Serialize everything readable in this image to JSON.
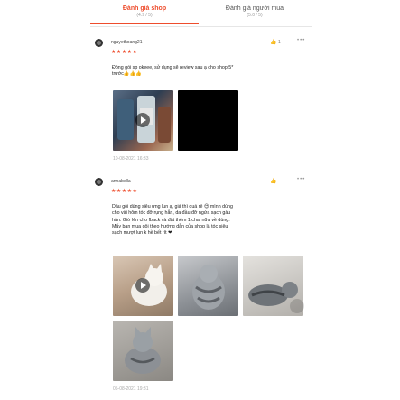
{
  "tabs": [
    {
      "label": "Đánh giá shop",
      "sub": "(4.9 / 5)"
    },
    {
      "label": "Đánh giá người mua",
      "sub": "(5.0 / 5)"
    }
  ],
  "reviews": [
    {
      "username": "nguyethoang21",
      "stars": "★★★★★",
      "like_count": "1",
      "comment": "Đóng gói sp okeee, sử dụng sẽ review sau ạ cho shop 5*\ntrước👍👍👍",
      "timestamp": "10-08-2021 16:33"
    },
    {
      "username": "annabella",
      "stars": "★★★★★",
      "like_count": "",
      "comment": "Dầu gội dùng siêu ưng lun ạ, giá thì quá rẻ 😍 mình dùng\ncho vài hôm tóc đỡ rụng hẳn, da đầu đỡ ngứa sạch gàu\nhẳn. Giờ lên cho fback và đặt thêm 1 chai nữa về dùng.\nMấy bạn mua gội theo hướng dẫn của shop là tóc siêu\nsạch mượt lun k hề bết rít ❤",
      "timestamp": "05-08-2021 19:31"
    }
  ],
  "icons": {
    "like": "thumbs-up-icon",
    "more": "more-options-icon",
    "play": "play-icon"
  },
  "colors": {
    "accent": "#ee4d2d",
    "muted": "#999999"
  }
}
